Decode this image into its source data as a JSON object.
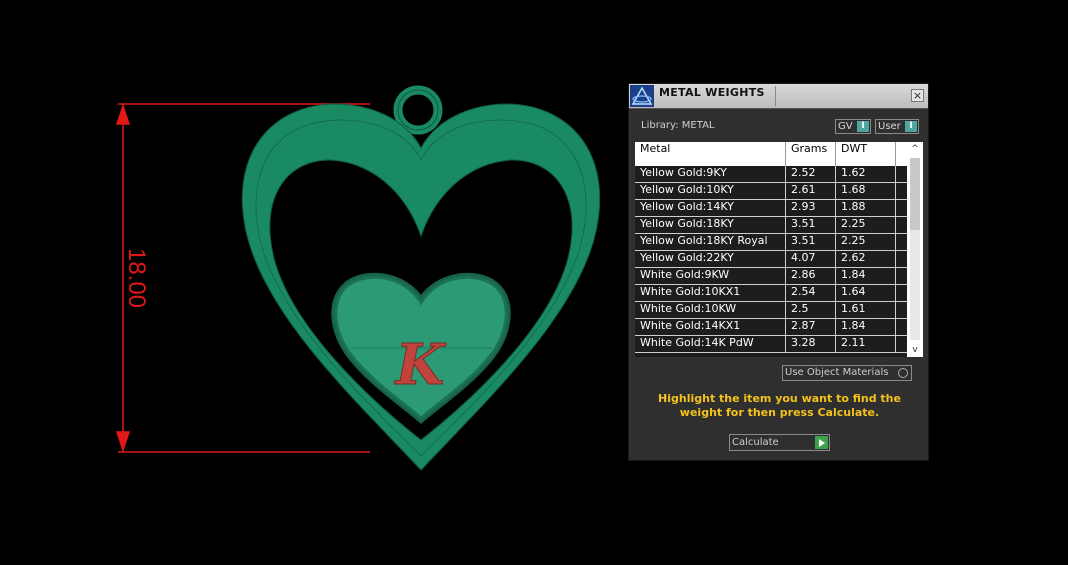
{
  "viewport": {
    "dimension_label": "18.00",
    "pendant_letter": "K",
    "colors": {
      "pendant": "#1a8a62",
      "dimension": "#e01818",
      "letter": "#c0443c"
    }
  },
  "panel": {
    "title": "METAL WEIGHTS",
    "close_glyph": "×",
    "library_label": "Library: METAL",
    "toggle_gv": "GV",
    "toggle_user": "User",
    "table": {
      "headers": [
        "Metal",
        "Grams",
        "DWT"
      ],
      "rows": [
        [
          "Yellow Gold:9KY",
          "2.52",
          "1.62"
        ],
        [
          "Yellow Gold:10KY",
          "2.61",
          "1.68"
        ],
        [
          "Yellow Gold:14KY",
          "2.93",
          "1.88"
        ],
        [
          "Yellow Gold:18KY",
          "3.51",
          "2.25"
        ],
        [
          "Yellow Gold:18KY Royal",
          "3.51",
          "2.25"
        ],
        [
          "Yellow Gold:22KY",
          "4.07",
          "2.62"
        ],
        [
          "White Gold:9KW",
          "2.86",
          "1.84"
        ],
        [
          "White Gold:10KX1",
          "2.54",
          "1.64"
        ],
        [
          "White Gold:10KW",
          "2.5",
          "1.61"
        ],
        [
          "White Gold:14KX1",
          "2.87",
          "1.84"
        ],
        [
          "White Gold:14K PdW",
          "3.28",
          "2.11"
        ]
      ]
    },
    "use_object_materials": "Use Object Materials",
    "hint_text": "Highlight the item you want to find the weight for then press Calculate.",
    "calculate_label": "Calculate",
    "accent_color": "#f4c21c"
  }
}
